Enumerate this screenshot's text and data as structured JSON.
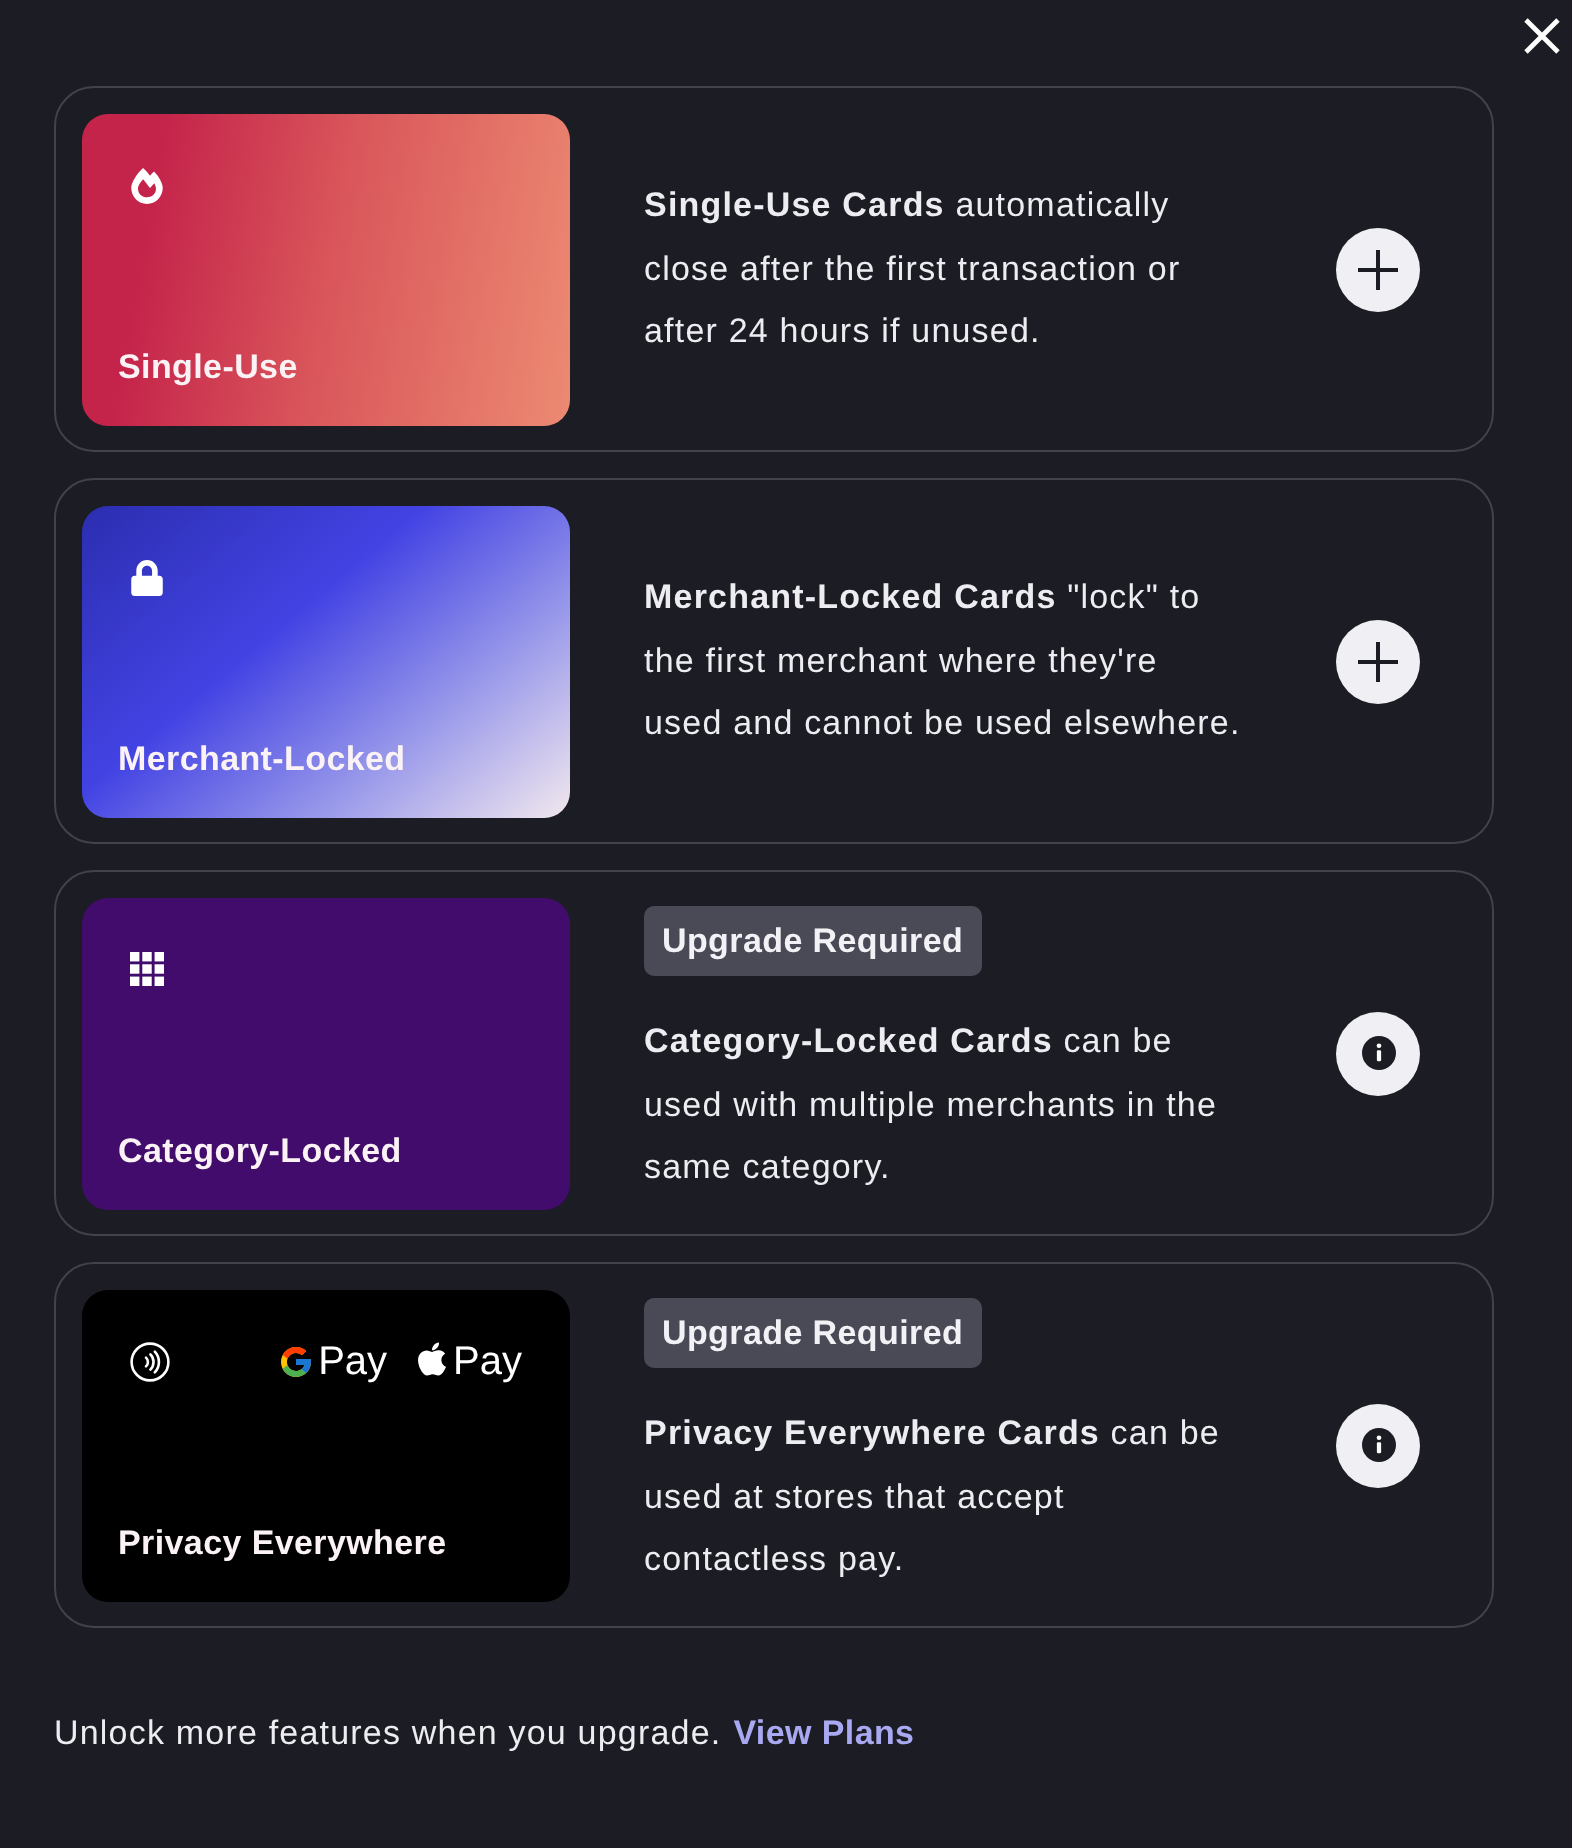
{
  "options": [
    {
      "kind": "single-use",
      "card_label": "Single-Use",
      "description": "**Single-Use Cards** automatically close after the first transaction or after 24 hours if unused.",
      "locked": false
    },
    {
      "kind": "merchant-locked",
      "card_label": "Merchant-Locked",
      "description": "**Merchant-Locked Cards** \"lock\" to the first merchant where they're used and cannot be used elsewhere.",
      "locked": false
    },
    {
      "kind": "category-locked",
      "card_label": "Category-Locked",
      "badge": "Upgrade Required",
      "description": "**Category-Locked Cards** can be used with multiple merchants in the same category.",
      "locked": true
    },
    {
      "kind": "privacy-everywhere",
      "card_label": "Privacy Everywhere",
      "wallets": [
        {
          "kind": "google",
          "label": "Pay"
        },
        {
          "kind": "apple",
          "label": "Pay"
        }
      ],
      "badge": "Upgrade Required",
      "description": "**Privacy Everywhere Cards** can be used at stores that accept contactless pay.",
      "locked": true
    }
  ],
  "footer": {
    "text": "Unlock more features when you upgrade.",
    "link": "View Plans"
  }
}
